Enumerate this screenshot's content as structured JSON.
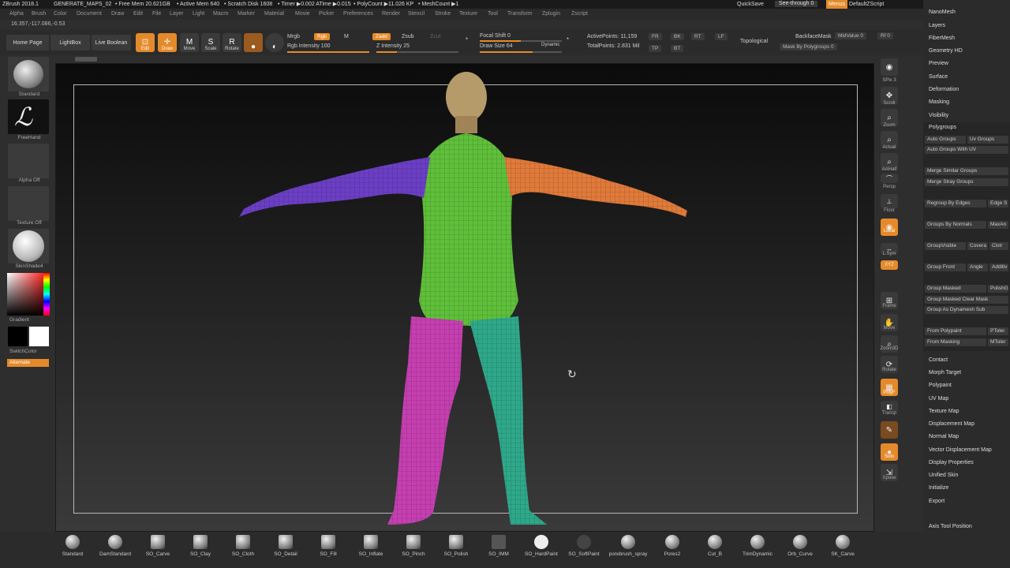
{
  "title_bar": {
    "app": "ZBrush 2018.1",
    "project": "GENERATE_MAPS_02",
    "free_mem": "• Free Mem 20.621GB",
    "active_mem": "• Active Mem 640",
    "scratch": "• Scratch Disk 1608",
    "timer": "• Timer ▶0.002 ATime ▶0.015",
    "polycount": "• PolyCount ▶11.026 KP",
    "meshcount": "• MeshCount ▶1",
    "quicksave": "QuickSave",
    "see_through": "See-through  0",
    "menus": "Menus",
    "script": "DefaultZScript"
  },
  "menu": [
    "Alpha",
    "Brush",
    "Color",
    "Document",
    "Draw",
    "Edit",
    "File",
    "Layer",
    "Light",
    "Macro",
    "Marker",
    "Material",
    "Movie",
    "Picker",
    "Preferences",
    "Render",
    "Stencil",
    "Stroke",
    "Texture",
    "Tool",
    "Transform",
    "Zplugin",
    "Zscript"
  ],
  "coords": "16.357,-117.086,-0.53",
  "shelf": {
    "home_page": "Home Page",
    "lightbox": "LightBox",
    "live_boolean": "Live Boolean",
    "edit": "Edit",
    "draw": "Draw",
    "move": "Move",
    "scale": "Scale",
    "rotate": "Rotate",
    "mrgb": "Mrgb",
    "rgb": "Rgb",
    "m": "M",
    "rgb_intensity": "Rgb Intensity 100",
    "zadd": "Zadd",
    "zsub": "Zsub",
    "zcut": "Zcut",
    "z_intensity": "Z Intensity 25",
    "focal_shift": "Focal Shift 0",
    "draw_size": "Draw Size 64",
    "dynamic": "Dynamic",
    "active_points": "ActivePoints: 11,159",
    "total_points": "TotalPoints: 2.831 Mil",
    "fr": "FR",
    "bk": "BK",
    "rt": "RT",
    "lf": "LF",
    "tp": "TP",
    "bt": "BT",
    "topological": "Topological",
    "backface_mask": "BackfaceMask",
    "midvalue": "MidValue 0",
    "rf": "Rf 0",
    "mask_by_polygroups": "Mask By Polygroups 0"
  },
  "left_tray": {
    "standard": "Standard",
    "freehand": "FreeHand",
    "alpha_off": "Alpha Off",
    "texture_off": "Texture Off",
    "material": "SkinShade4",
    "gradient": "Gradient",
    "switch_color": "SwitchColor",
    "alternate": "Alternate"
  },
  "right_shelf": [
    "SPix 3",
    "Scroll",
    "Zoom",
    "Actual",
    "AAHalf",
    "Persp",
    "Floor",
    "Local",
    "L.Sym",
    "XYZ",
    "Frame",
    "Move",
    "Zoom3D",
    "Rotate",
    "PolyF",
    "Transp",
    "Solo",
    "Xpose"
  ],
  "right_tray": {
    "top_items": [
      "NanoMesh",
      "Layers",
      "FiberMesh",
      "Geometry HD",
      "Preview",
      "Surface",
      "Deformation",
      "Masking",
      "Visibility"
    ],
    "polygroups_header": "Polygroups",
    "polygroup_buttons": [
      "Auto Groups",
      "Uv Groups",
      "Auto Groups With UV",
      "Merge Similar Groups",
      "Merge Stray Groups",
      "Regroup By Edges",
      "Edge S",
      "Groups By Normals",
      "MaxAn",
      "GroupVisible",
      "Covera",
      "Clstr",
      "Group Front",
      "Angle",
      "Additiv",
      "Group Masked",
      "PolishG",
      "Group Masked Clear Mask",
      "Group As Dynamesh Sub",
      "From Polypaint",
      "PToler",
      "From Masking",
      "MToler"
    ],
    "bottom_items": [
      "Contact",
      "Morph Target",
      "Polypaint",
      "UV Map",
      "Texture Map",
      "Displacement Map",
      "Normal Map",
      "Vector Displacement Map",
      "Display Properties",
      "Unified Skin",
      "Initialize",
      "Export",
      "Axis Tool Position"
    ]
  },
  "bottom_shelf": [
    "Standard",
    "DamStandard",
    "SO_Carve",
    "SO_Clay",
    "SO_Cloth",
    "SO_Detail",
    "SO_Fill",
    "SO_Inflate",
    "SO_Pinch",
    "SO_Polish",
    "SO_IMM",
    "SO_HardPaint",
    "SO_SoftPaint",
    "porebrush_spray",
    "Pores2",
    "Cut_B",
    "TrimDynamic",
    "Orb_Curve",
    "SK_Carve"
  ],
  "colors": {
    "accent": "#e58a2a",
    "torso_group": "#5fbf3a",
    "left_arm_group": "#6b3fc4",
    "right_arm_group": "#e07a3a",
    "left_leg_group": "#c53fb0",
    "right_leg_group": "#2fa88a"
  }
}
